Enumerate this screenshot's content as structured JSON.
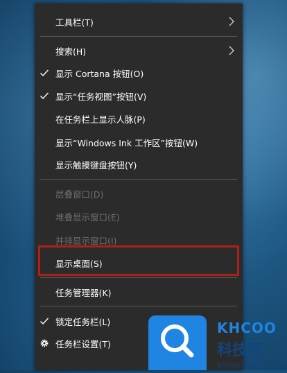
{
  "menu": {
    "items": [
      {
        "label": "工具栏(T)",
        "checked": false,
        "disabled": false,
        "submenu": true,
        "gear": false
      },
      {
        "label": "搜索(H)",
        "checked": false,
        "disabled": false,
        "submenu": true,
        "gear": false
      },
      {
        "label": "显示 Cortana 按钮(O)",
        "checked": true,
        "disabled": false,
        "submenu": false,
        "gear": false
      },
      {
        "label": "显示“任务视图”按钮(V)",
        "checked": true,
        "disabled": false,
        "submenu": false,
        "gear": false
      },
      {
        "label": "在任务栏上显示人脉(P)",
        "checked": false,
        "disabled": false,
        "submenu": false,
        "gear": false
      },
      {
        "label": "显示“Windows Ink 工作区”按钮(W)",
        "checked": false,
        "disabled": false,
        "submenu": false,
        "gear": false
      },
      {
        "label": "显示触摸键盘按钮(Y)",
        "checked": false,
        "disabled": false,
        "submenu": false,
        "gear": false
      },
      {
        "label": "层叠窗口(D)",
        "checked": false,
        "disabled": true,
        "submenu": false,
        "gear": false
      },
      {
        "label": "堆叠显示窗口(E)",
        "checked": false,
        "disabled": true,
        "submenu": false,
        "gear": false
      },
      {
        "label": "并排显示窗口(I)",
        "checked": false,
        "disabled": true,
        "submenu": false,
        "gear": false
      },
      {
        "label": "显示桌面(S)",
        "checked": false,
        "disabled": false,
        "submenu": false,
        "gear": false
      },
      {
        "label": "任务管理器(K)",
        "checked": false,
        "disabled": false,
        "submenu": false,
        "gear": false
      },
      {
        "label": "锁定任务栏(L)",
        "checked": true,
        "disabled": false,
        "submenu": false,
        "gear": false
      },
      {
        "label": "任务栏设置(T)",
        "checked": false,
        "disabled": false,
        "submenu": false,
        "gear": true
      }
    ]
  },
  "watermark": {
    "brand_en": "KHCOO",
    "brand_cn": "科技库",
    "domain": "khcoo.com"
  },
  "colors": {
    "menu_bg": "#2b2b2b",
    "highlight_border": "#b0201b",
    "logo_blue": "#1f84e2"
  }
}
